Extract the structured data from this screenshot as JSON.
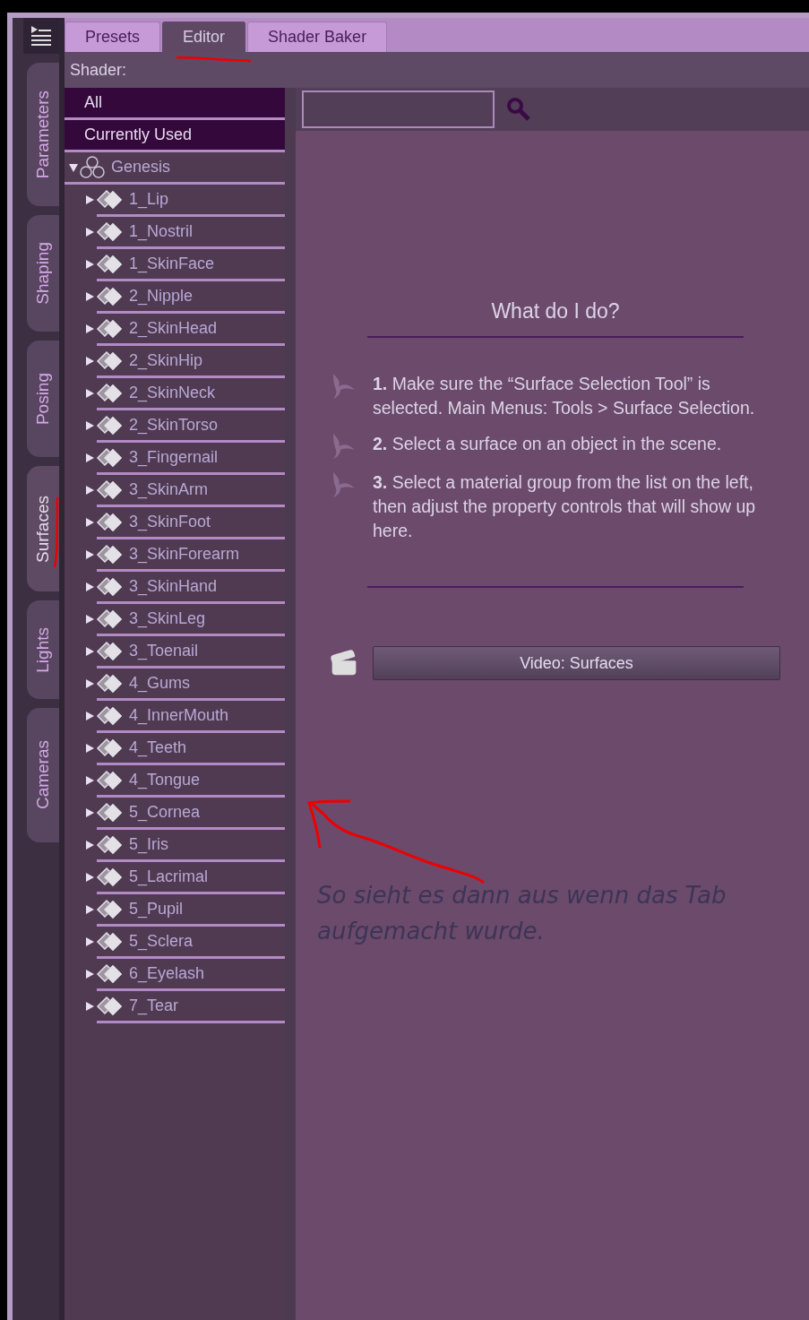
{
  "tabs": [
    {
      "label": "Presets",
      "selected": false
    },
    {
      "label": "Editor",
      "selected": true
    },
    {
      "label": "Shader Baker",
      "selected": false
    }
  ],
  "side_tabs": [
    {
      "label": "Parameters",
      "selected": false
    },
    {
      "label": "Shaping",
      "selected": false
    },
    {
      "label": "Posing",
      "selected": false
    },
    {
      "label": "Surfaces",
      "selected": true
    },
    {
      "label": "Lights",
      "selected": false
    },
    {
      "label": "Cameras",
      "selected": false
    }
  ],
  "shader_label": "Shader:",
  "shader_list": {
    "filters": [
      {
        "label": "All"
      },
      {
        "label": "Currently Used"
      }
    ],
    "tree": {
      "label": "Genesis",
      "expanded": true,
      "children": [
        {
          "label": "1_Lip",
          "expanded": false
        },
        {
          "label": "1_Nostril",
          "expanded": false
        },
        {
          "label": "1_SkinFace",
          "expanded": false
        },
        {
          "label": "2_Nipple",
          "expanded": false
        },
        {
          "label": "2_SkinHead",
          "expanded": false
        },
        {
          "label": "2_SkinHip",
          "expanded": false
        },
        {
          "label": "2_SkinNeck",
          "expanded": false
        },
        {
          "label": "2_SkinTorso",
          "expanded": false
        },
        {
          "label": "3_Fingernail",
          "expanded": false
        },
        {
          "label": "3_SkinArm",
          "expanded": false
        },
        {
          "label": "3_SkinFoot",
          "expanded": false
        },
        {
          "label": "3_SkinForearm",
          "expanded": false
        },
        {
          "label": "3_SkinHand",
          "expanded": false
        },
        {
          "label": "3_SkinLeg",
          "expanded": false
        },
        {
          "label": "3_Toenail",
          "expanded": false
        },
        {
          "label": "4_Gums",
          "expanded": false
        },
        {
          "label": "4_InnerMouth",
          "expanded": false
        },
        {
          "label": "4_Teeth",
          "expanded": false
        },
        {
          "label": "4_Tongue",
          "expanded": false
        },
        {
          "label": "5_Cornea",
          "expanded": false
        },
        {
          "label": "5_Iris",
          "expanded": false
        },
        {
          "label": "5_Lacrimal",
          "expanded": false
        },
        {
          "label": "5_Pupil",
          "expanded": false
        },
        {
          "label": "5_Sclera",
          "expanded": false
        },
        {
          "label": "6_Eyelash",
          "expanded": false
        },
        {
          "label": "7_Tear",
          "expanded": false
        }
      ]
    }
  },
  "help": {
    "title": "What do I do?",
    "steps": [
      "**1.** Make sure the “Surface Selection Tool” is selected. Main Menus: Tools > Surface Selection.",
      "**2.** Select a surface on an object in the scene.",
      "**3.** Select a material group from the list on the left, then adjust the property controls that will show up here."
    ],
    "video_button": "Video: Surfaces"
  },
  "annotation": "So sieht es dann aus wenn das Tab aufgemacht wurde."
}
